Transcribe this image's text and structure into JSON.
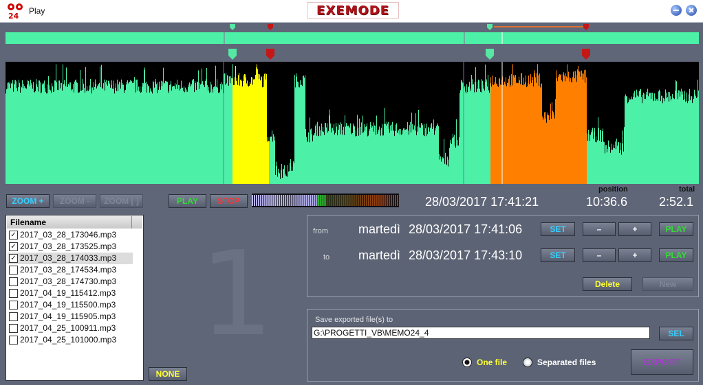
{
  "window": {
    "title": "Play",
    "brand": "EXEMODE"
  },
  "toolbar": {
    "zoom_in": "ZOOM +",
    "zoom_out": "ZOOM -",
    "zoom_reset": "ZOOM [ ]",
    "play": "PLAY",
    "stop": "STOP"
  },
  "readout": {
    "current_datetime": "28/03/2017 17:41:21",
    "position_label": "position",
    "position_value": "10:36.6",
    "total_label": "total",
    "total_value": "2:52.1"
  },
  "filelist": {
    "header": "Filename",
    "items": [
      {
        "name": "2017_03_28_173046.mp3",
        "checked": true
      },
      {
        "name": "2017_03_28_173525.mp3",
        "checked": true
      },
      {
        "name": "2017_03_28_174033.mp3",
        "checked": true
      },
      {
        "name": "2017_03_28_174534.mp3",
        "checked": false
      },
      {
        "name": "2017_03_28_174730.mp3",
        "checked": false
      },
      {
        "name": "2017_04_19_115412.mp3",
        "checked": false
      },
      {
        "name": "2017_04_19_115500.mp3",
        "checked": false
      },
      {
        "name": "2017_04_19_115905.mp3",
        "checked": false
      },
      {
        "name": "2017_04_25_100911.mp3",
        "checked": false
      },
      {
        "name": "2017_04_25_101000.mp3",
        "checked": false
      }
    ],
    "none_button": "NONE"
  },
  "segment": {
    "number": "1",
    "from_label": "from",
    "from_day": "martedì",
    "from_datetime": "28/03/2017 17:41:06",
    "to_label": "to",
    "to_day": "martedì",
    "to_datetime": "28/03/2017 17:43:10",
    "set_label": "SET",
    "minus_label": "–",
    "plus_label": "+",
    "play_label": "PLAY",
    "delete_label": "Delete",
    "new_label": "New"
  },
  "export": {
    "title": "Save exported file(s) to",
    "path": "G:\\PROGETTI_VB\\MEMO24_4",
    "sel_label": "SEL",
    "one_file": "One file",
    "separated_files": "Separated files",
    "selected_mode": "one",
    "export_label": "EXPORT"
  },
  "colors": {
    "wave": "#4cf0a6",
    "yellow_sel": "#ffff00",
    "orange_sel": "#ff8000",
    "marker_green": "#56e7a4",
    "marker_red": "#c41717"
  },
  "vu_level": 0.5
}
